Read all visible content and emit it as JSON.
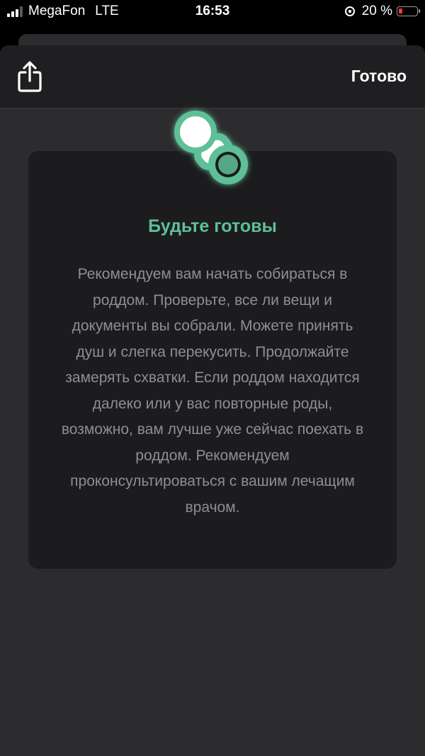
{
  "status_bar": {
    "carrier": "MegaFon",
    "network": "LTE",
    "time": "16:53",
    "battery": "20 %",
    "battery_level": 0.2,
    "signal_bars": 3
  },
  "header": {
    "done_label": "Готово",
    "share_icon": "share-icon"
  },
  "card": {
    "icon": "pacifier-icon",
    "title": "Будьте готовы",
    "body": "Рекомендуем вам начать собираться в роддом. Проверьте, все ли вещи и документы вы собрали. Можете принять душ и слегка перекусить. Продолжайте замерять схватки. Если роддом находится далеко или у вас повторные роды, возможно, вам лучше уже сейчас поехать в роддом. Рекомендуем проконсультироваться с вашим лечащим врачом."
  },
  "colors": {
    "accent": "#5fbf98",
    "battery_low": "#ff3b30",
    "sheet_background": "#2c2c2e",
    "card_background": "#1c1c1e"
  }
}
